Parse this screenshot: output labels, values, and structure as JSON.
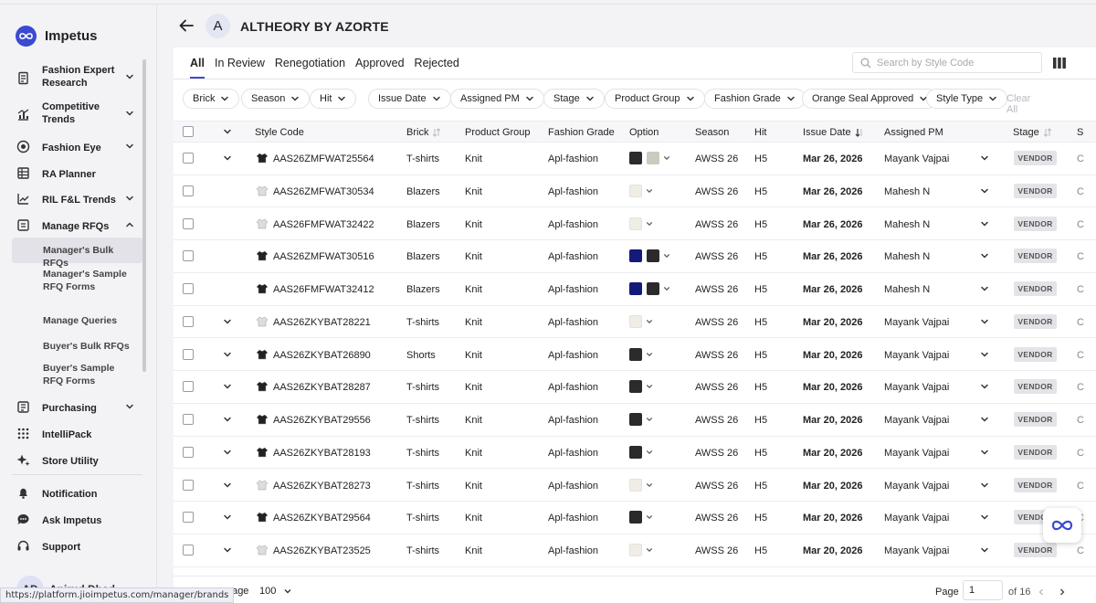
{
  "app": {
    "name": "Impetus",
    "brand_title": "ALTHEORY BY AZORTE",
    "brand_initial": "A"
  },
  "sidebar": {
    "items": [
      {
        "label": "Fashion Expert Research",
        "icon": "document-icon"
      },
      {
        "label": "Competitive Trends",
        "icon": "chart-icon"
      },
      {
        "label": "Fashion Eye",
        "icon": "eye-icon"
      },
      {
        "label": "RA Planner",
        "icon": "grid-icon"
      },
      {
        "label": "RIL F&L Trends",
        "icon": "trend-icon"
      },
      {
        "label": "Manage RFQs",
        "icon": "folder-icon"
      }
    ],
    "sub_items": [
      {
        "label": "Manager's Bulk RFQs"
      },
      {
        "label": "Manager's Sample RFQ Forms"
      },
      {
        "label": "Manage Queries"
      },
      {
        "label": "Buyer's Bulk RFQs"
      },
      {
        "label": "Buyer's Sample RFQ Forms"
      }
    ],
    "items2": [
      {
        "label": "Purchasing",
        "icon": "cart-icon"
      },
      {
        "label": "IntelliPack",
        "icon": "dots-grid-icon"
      },
      {
        "label": "Store Utility",
        "icon": "sparkle-icon"
      }
    ],
    "bottom": [
      {
        "label": "Notification",
        "icon": "bell-icon"
      },
      {
        "label": "Ask Impetus",
        "icon": "chat-icon"
      },
      {
        "label": "Support",
        "icon": "headset-icon"
      }
    ],
    "user": {
      "initials": "AD",
      "name": "Anirud Dhad..."
    },
    "status_url": "https://platform.jioimpetus.com/manager/brands"
  },
  "tabs": [
    "All",
    "In Review",
    "Renegotiation",
    "Approved",
    "Rejected"
  ],
  "search": {
    "placeholder": "Search by Style Code"
  },
  "filters": [
    "Brick",
    "Season",
    "Hit",
    "Issue Date",
    "Assigned PM",
    "Stage",
    "Product Group",
    "Fashion Grade",
    "Orange Seal Approved",
    "Style Type"
  ],
  "clear_all": "Clear All",
  "columns": [
    "Style Code",
    "Brick",
    "Product Group",
    "Fashion Grade",
    "Option",
    "Season",
    "Hit",
    "Issue Date",
    "Assigned PM",
    "Stage",
    "S"
  ],
  "rows": [
    {
      "code": "AAS26ZMFWAT25564",
      "brick": "T-shirts",
      "group": "Knit",
      "grade": "Apl-fashion",
      "swatches": [
        "#2b2b2e",
        "#c7cbc0"
      ],
      "season": "AWSS 26",
      "hit": "H5",
      "date": "Mar 26, 2026",
      "pm": "Mayank Vajpai",
      "stage": "VENDOR",
      "expand": true,
      "s": "C"
    },
    {
      "code": "AAS26ZMFWAT30534",
      "brick": "Blazers",
      "group": "Knit",
      "grade": "Apl-fashion",
      "swatches": [
        "#f0ede7"
      ],
      "season": "AWSS 26",
      "hit": "H5",
      "date": "Mar 26, 2026",
      "pm": "Mahesh N",
      "stage": "VENDOR",
      "expand": false,
      "s": "C"
    },
    {
      "code": "AAS26FMFWAT32422",
      "brick": "Blazers",
      "group": "Knit",
      "grade": "Apl-fashion",
      "swatches": [
        "#f0ede7"
      ],
      "season": "AWSS 26",
      "hit": "H5",
      "date": "Mar 26, 2026",
      "pm": "Mahesh N",
      "stage": "VENDOR",
      "expand": false,
      "s": "C"
    },
    {
      "code": "AAS26ZMFWAT30516",
      "brick": "Blazers",
      "group": "Knit",
      "grade": "Apl-fashion",
      "swatches": [
        "#141a7a",
        "#2b2b2e"
      ],
      "season": "AWSS 26",
      "hit": "H5",
      "date": "Mar 26, 2026",
      "pm": "Mahesh N",
      "stage": "VENDOR",
      "expand": false,
      "s": "C"
    },
    {
      "code": "AAS26FMFWAT32412",
      "brick": "Blazers",
      "group": "Knit",
      "grade": "Apl-fashion",
      "swatches": [
        "#141a7a",
        "#2b2b2e"
      ],
      "season": "AWSS 26",
      "hit": "H5",
      "date": "Mar 26, 2026",
      "pm": "Mahesh N",
      "stage": "VENDOR",
      "expand": false,
      "s": "C"
    },
    {
      "code": "AAS26ZKYBAT28221",
      "brick": "T-shirts",
      "group": "Knit",
      "grade": "Apl-fashion",
      "swatches": [
        "#f0ede7"
      ],
      "season": "AWSS 26",
      "hit": "H5",
      "date": "Mar 20, 2026",
      "pm": "Mayank Vajpai",
      "stage": "VENDOR",
      "expand": true,
      "s": "C"
    },
    {
      "code": "AAS26ZKYBAT26890",
      "brick": "Shorts",
      "group": "Knit",
      "grade": "Apl-fashion",
      "swatches": [
        "#2b2b2e"
      ],
      "season": "AWSS 26",
      "hit": "H5",
      "date": "Mar 20, 2026",
      "pm": "Mayank Vajpai",
      "stage": "VENDOR",
      "expand": true,
      "s": "C"
    },
    {
      "code": "AAS26ZKYBAT28287",
      "brick": "T-shirts",
      "group": "Knit",
      "grade": "Apl-fashion",
      "swatches": [
        "#2b2b2e"
      ],
      "season": "AWSS 26",
      "hit": "H5",
      "date": "Mar 20, 2026",
      "pm": "Mayank Vajpai",
      "stage": "VENDOR",
      "expand": true,
      "s": "C"
    },
    {
      "code": "AAS26ZKYBAT29556",
      "brick": "T-shirts",
      "group": "Knit",
      "grade": "Apl-fashion",
      "swatches": [
        "#2b2b2e"
      ],
      "season": "AWSS 26",
      "hit": "H5",
      "date": "Mar 20, 2026",
      "pm": "Mayank Vajpai",
      "stage": "VENDOR",
      "expand": true,
      "s": "C"
    },
    {
      "code": "AAS26ZKYBAT28193",
      "brick": "T-shirts",
      "group": "Knit",
      "grade": "Apl-fashion",
      "swatches": [
        "#2b2b2e"
      ],
      "season": "AWSS 26",
      "hit": "H5",
      "date": "Mar 20, 2026",
      "pm": "Mayank Vajpai",
      "stage": "VENDOR",
      "expand": true,
      "s": "C"
    },
    {
      "code": "AAS26ZKYBAT28273",
      "brick": "T-shirts",
      "group": "Knit",
      "grade": "Apl-fashion",
      "swatches": [
        "#f0ede7"
      ],
      "season": "AWSS 26",
      "hit": "H5",
      "date": "Mar 20, 2026",
      "pm": "Mayank Vajpai",
      "stage": "VENDOR",
      "expand": true,
      "s": "C"
    },
    {
      "code": "AAS26ZKYBAT29564",
      "brick": "T-shirts",
      "group": "Knit",
      "grade": "Apl-fashion",
      "swatches": [
        "#2b2b2e"
      ],
      "season": "AWSS 26",
      "hit": "H5",
      "date": "Mar 20, 2026",
      "pm": "Mayank Vajpai",
      "stage": "VENDOR",
      "expand": true,
      "s": "C"
    },
    {
      "code": "AAS26ZKYBAT23525",
      "brick": "T-shirts",
      "group": "Knit",
      "grade": "Apl-fashion",
      "swatches": [
        "#f0ede7"
      ],
      "season": "AWSS 26",
      "hit": "H5",
      "date": "Mar 20, 2026",
      "pm": "Mayank Vajpai",
      "stage": "VENDOR",
      "expand": true,
      "s": "C"
    }
  ],
  "footer": {
    "per_page_label": "per page",
    "per_page_value": "100",
    "page_label": "Page",
    "page_value": "1",
    "of_label": "of 16"
  },
  "colors": {
    "accent": "#3a4ad1",
    "stage_bg": "#e4e4e8"
  }
}
